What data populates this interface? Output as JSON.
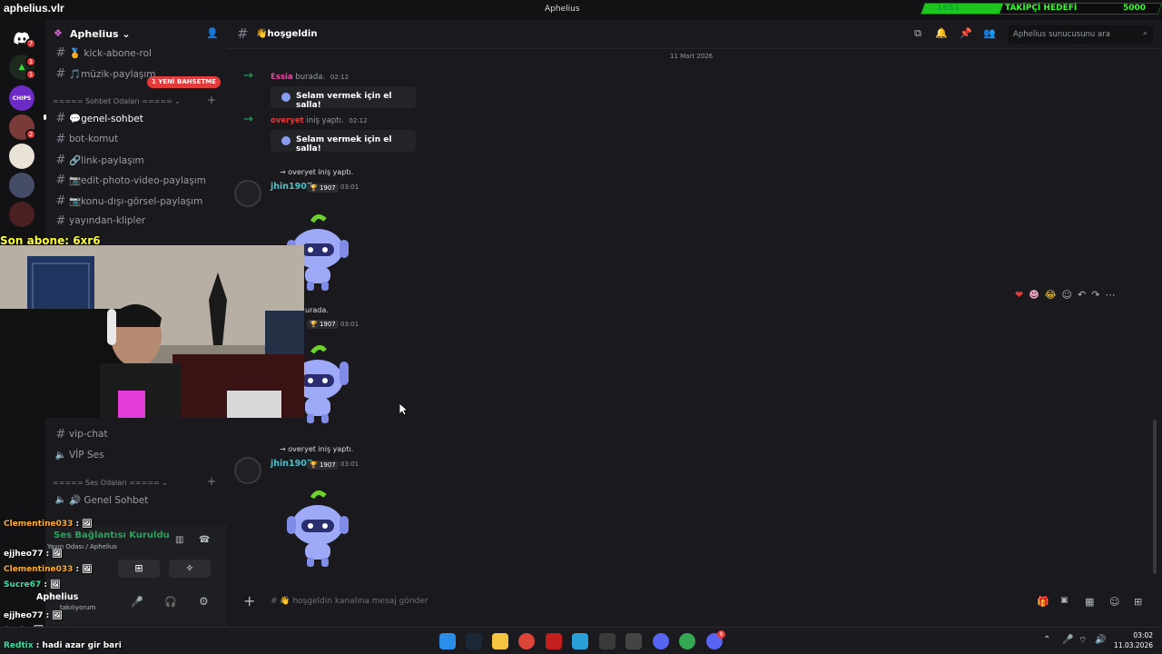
{
  "stream": {
    "name": "aphelius.vlr",
    "last_sub": "Son abone: 6xr6"
  },
  "window": {
    "title": "Aphelius"
  },
  "follow_goal": {
    "count": "1651",
    "label": "TAKİPÇİ HEDEFİ",
    "target": "5000",
    "progress": 0.33
  },
  "rail": {
    "badges": [
      "7",
      "1",
      "1",
      "2"
    ],
    "chips_label": "CHIPS"
  },
  "server": {
    "name": "Aphelius ⌄"
  },
  "channels": {
    "mention_pill": "1 YENİ BAHSETME",
    "top": [
      {
        "label": "🏅 kick-abone-rol"
      },
      {
        "label": "🎵müzik-paylaşım"
      }
    ],
    "category_chat": "===== Sohbet Odaları ===== ⌄",
    "chat_items": [
      {
        "label": "💬genel-sohbet"
      },
      {
        "label": "bot-komut"
      },
      {
        "label": "🔗link-paylaşım"
      },
      {
        "label": "📷edit-photo-video-paylaşım"
      },
      {
        "label": "📷konu-dışı-görsel-paylaşım"
      },
      {
        "label": "yayından-klipler"
      }
    ],
    "lower": [
      {
        "label": "vip-chat"
      },
      {
        "label": "VİP Ses"
      }
    ],
    "category_voice": "===== Ses Odaları ===== ⌄",
    "voice_items": [
      {
        "label": "🔊 Genel Sohbet"
      }
    ]
  },
  "user_panel": {
    "connection": "Ses Bağlantısı Kuruldu",
    "room": "Yayın Odası / Aphelius",
    "username": "Aphelius",
    "status": "takılıyorum"
  },
  "main": {
    "channel": "👋hoşgeldin",
    "search_placeholder": "Aphelius sunucusunu ara",
    "date": "11 Mart 2026",
    "composer_placeholder": "# 👋 hoşgeldin kanalına mesaj gönder"
  },
  "messages": {
    "sys1": {
      "user": "Ɛssia",
      "text": " burada.",
      "time": "02:12",
      "card": "Selam vermek için el salla!"
    },
    "sys2": {
      "user": "overyet",
      "text": " iniş yaptı.",
      "time": "02:12",
      "card": "Selam vermek için el salla!"
    },
    "m1": {
      "reply": "→ overyet iniş yaptı.",
      "author": "jhin1907",
      "tag": "🏆 1907",
      "time": "03:01"
    },
    "m2": {
      "reply": "urada.",
      "tag": "🏆 1907",
      "time": "03:01"
    },
    "m3": {
      "reply": "→ overyet iniş yaptı.",
      "author": "jhin1907",
      "tag": "🏆 1907",
      "time": "03:01"
    }
  },
  "stream_chat": [
    {
      "name": "Clementine033",
      "text": " : 🖼"
    },
    {
      "name": "ejjheo77",
      "text": " : 🖼"
    },
    {
      "name": "Clementine033",
      "text": " : 🖼"
    },
    {
      "name": "Sucre67",
      "text": " : 🖼"
    },
    {
      "name": "ejjheo77",
      "text": " : 🖼"
    },
    {
      "name": "6xr6",
      "text": " : 🖼"
    },
    {
      "name": "Redtix",
      "text": " : hadi azar gir bari"
    }
  ],
  "taskbar": {
    "time": "03:02",
    "date": "11.03.2026",
    "discord_badge": "8"
  },
  "colors": {
    "accent": "#5865f2",
    "online": "#23a55a",
    "goal": "#34ff2a",
    "mention": "#e23b3b"
  }
}
